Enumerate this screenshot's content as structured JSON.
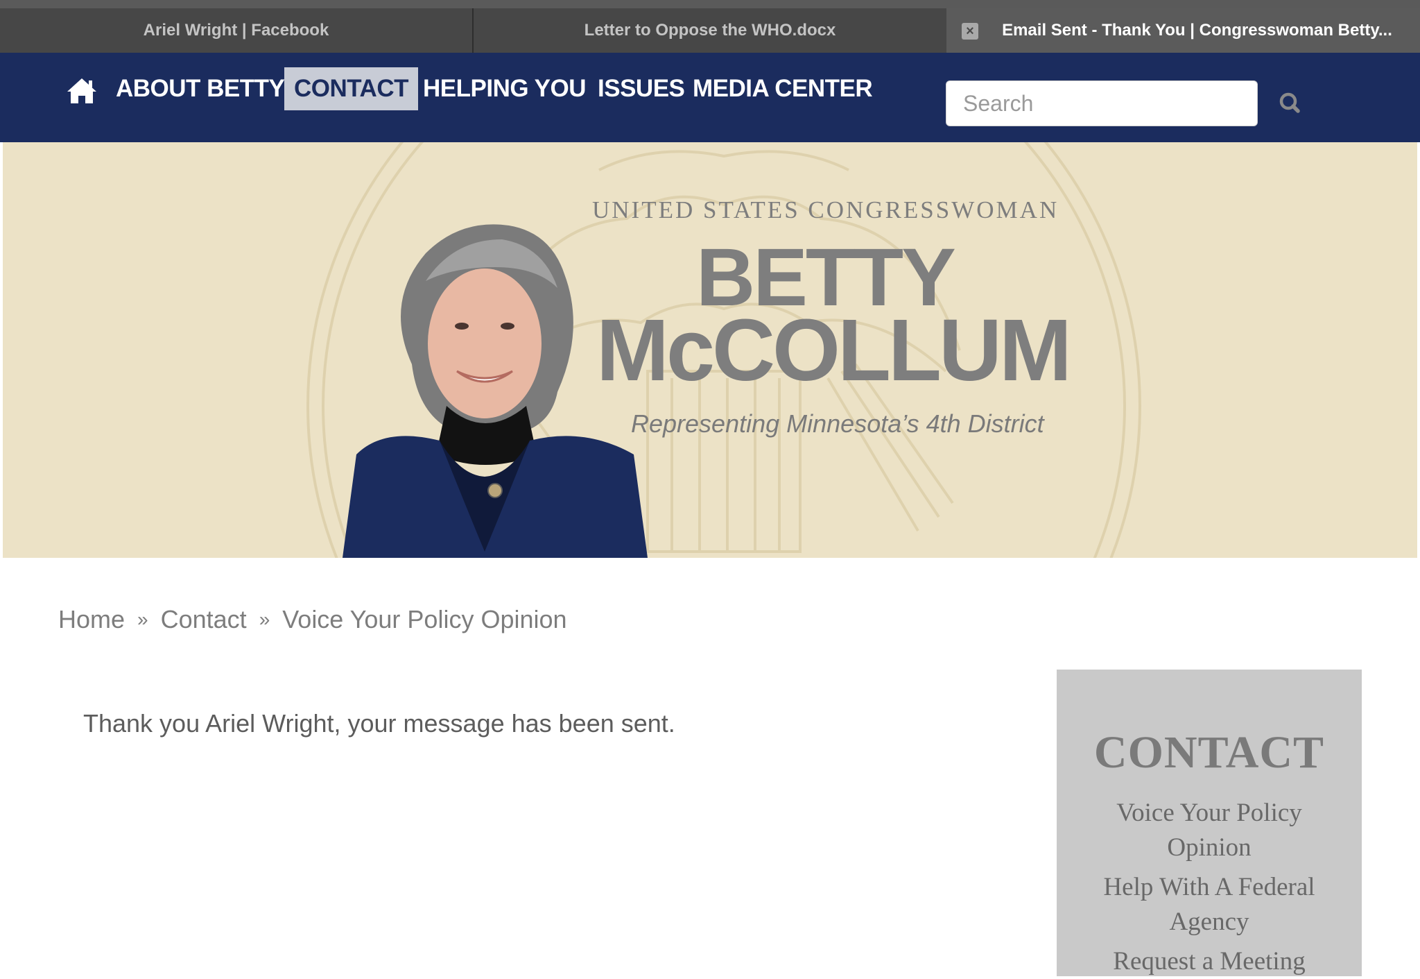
{
  "browser": {
    "tabs": [
      {
        "label": "Ariel Wright | Facebook"
      },
      {
        "label": "Letter to Oppose the WHO.docx"
      },
      {
        "label": "Email Sent - Thank You | Congresswoman Betty..."
      }
    ]
  },
  "nav": {
    "items": [
      {
        "label": "ABOUT BETTY"
      },
      {
        "label": "CONTACT"
      },
      {
        "label": "HELPING YOU"
      },
      {
        "label": "ISSUES"
      },
      {
        "label": "MEDIA CENTER"
      }
    ],
    "active_item": "CONTACT",
    "search_placeholder": "Search"
  },
  "banner": {
    "eyebrow": "UNITED STATES CONGRESSWOMAN",
    "first_name": "BETTY",
    "last_name": "McCOLLUM",
    "tagline": "Representing Minnesota’s 4th District"
  },
  "breadcrumb": {
    "items": [
      "Home",
      "Contact",
      "Voice Your Policy Opinion"
    ],
    "separator": "»"
  },
  "main": {
    "message": "Thank you Ariel Wright, your message has been sent."
  },
  "sidebar": {
    "title": "CONTACT",
    "links": [
      "Voice Your Policy Opinion",
      "Help With A Federal Agency",
      "Request a Meeting"
    ]
  },
  "colors": {
    "nav_bg": "#1b2c5e",
    "banner_bg": "#ece2c6",
    "sidebar_bg": "#c9c9c9",
    "tabbar_bg": "#4a4a4a"
  }
}
